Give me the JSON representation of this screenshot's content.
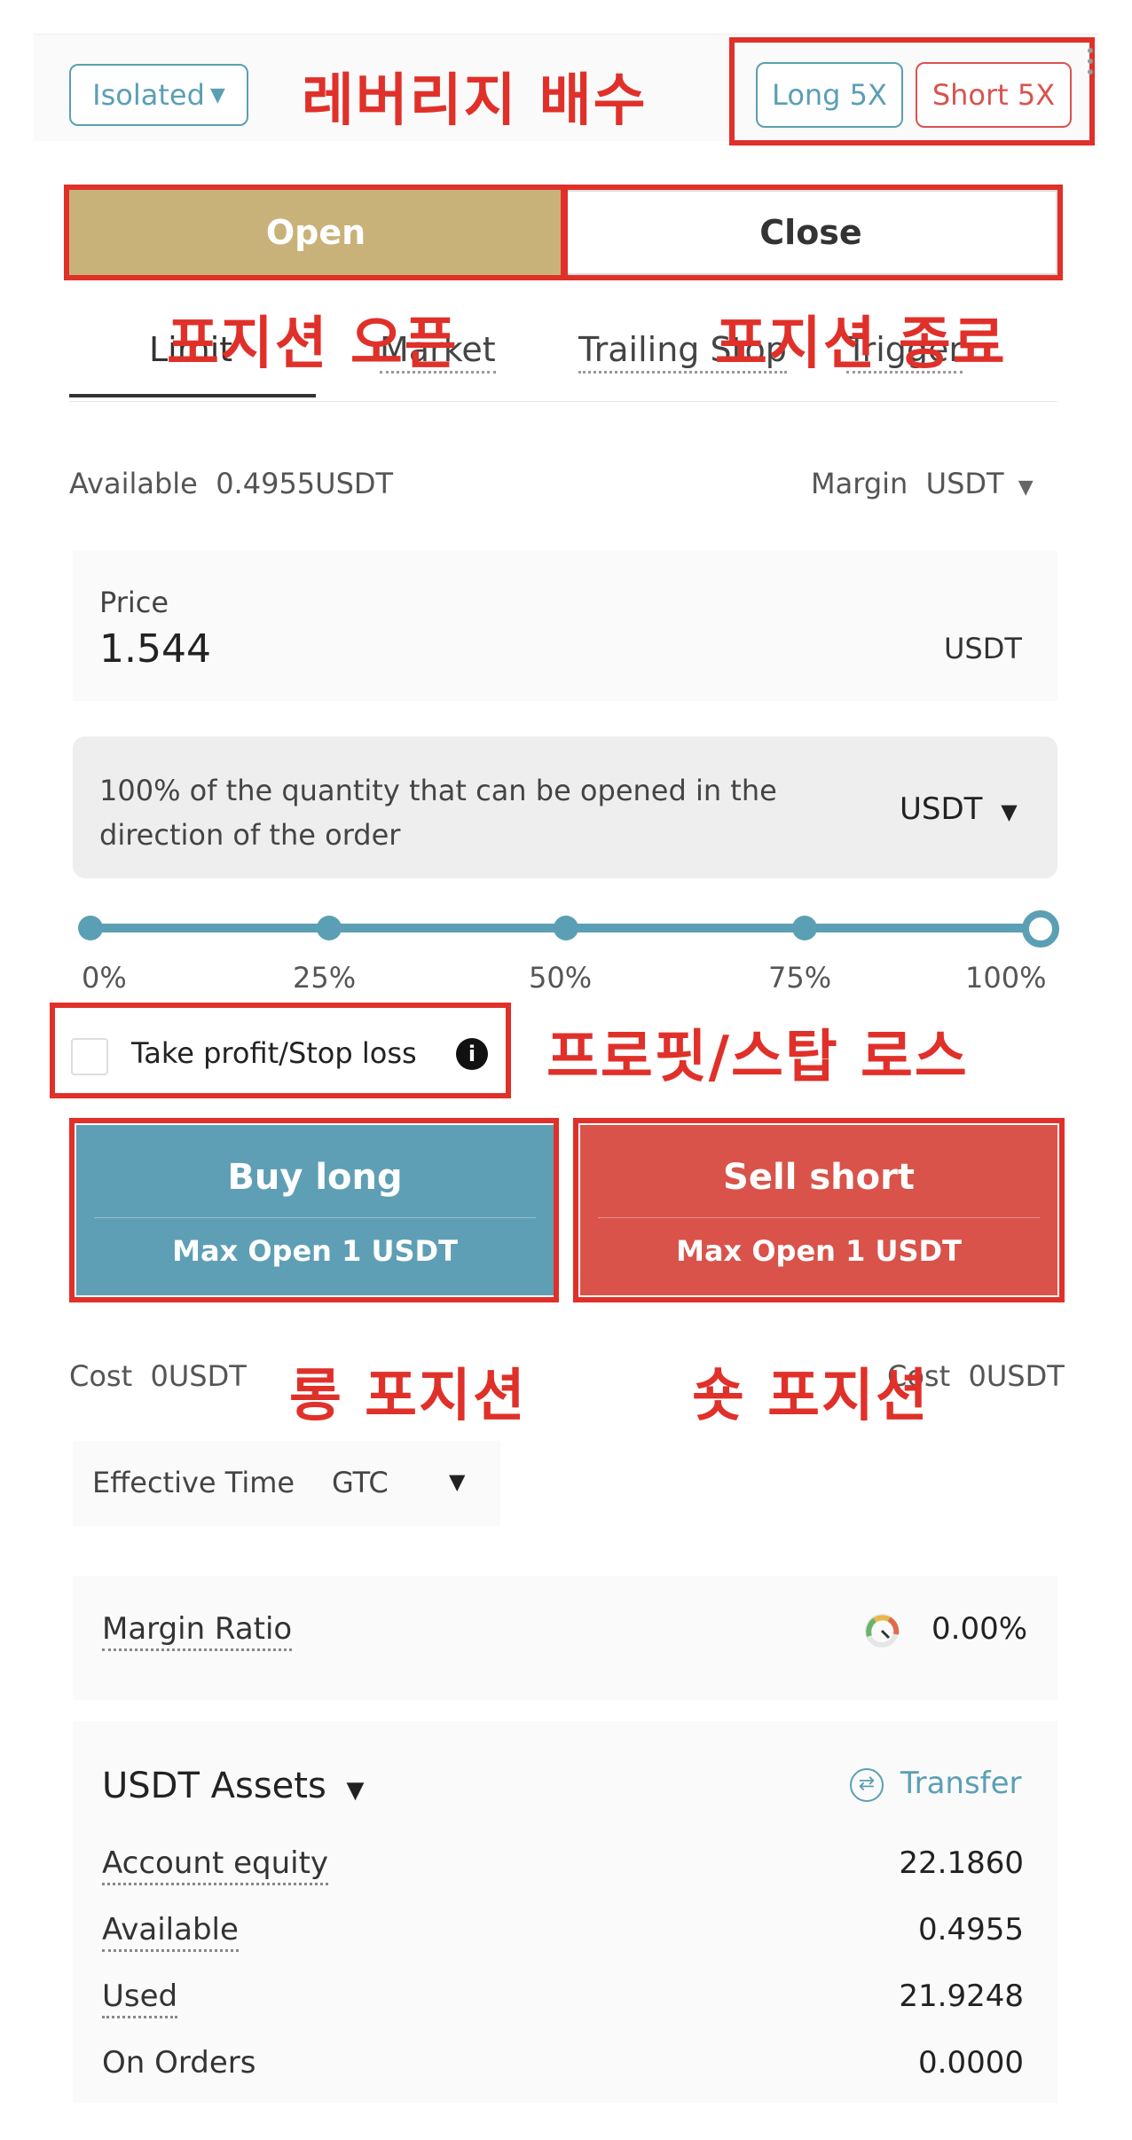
{
  "header": {
    "margin_mode": "Isolated",
    "long_leverage": "Long 5X",
    "short_leverage": "Short 5X"
  },
  "annotations": {
    "leverage": "레버리지 배수",
    "open_position": "포지션 오픈",
    "close_position": "포지션 종료",
    "take_profit_stop_loss": "프로핏/스탑 로스",
    "long_position": "롱 포지션",
    "short_position": "숏 포지션"
  },
  "mode_toggle": {
    "open": "Open",
    "close": "Close"
  },
  "order_tabs": [
    {
      "label": "Limit",
      "active": true
    },
    {
      "label": "Market"
    },
    {
      "label": "Trailing Stop"
    },
    {
      "label": "Trigger"
    }
  ],
  "available": {
    "label": "Available",
    "value": "0.4955USDT"
  },
  "margin": {
    "label": "Margin",
    "currency": "USDT"
  },
  "price": {
    "label": "Price",
    "value": "1.544",
    "unit": "USDT"
  },
  "quantity": {
    "text": "100% of the quantity that can be opened in the direction of the order",
    "unit": "USDT"
  },
  "slider": {
    "marks": [
      "0%",
      "25%",
      "50%",
      "75%",
      "100%"
    ],
    "value_percent": 100
  },
  "tpsl": {
    "label": "Take profit/Stop loss",
    "checked": false
  },
  "actions": {
    "buy": {
      "label": "Buy long",
      "sub": "Max Open 1 USDT",
      "color": "#5e9fb5"
    },
    "sell": {
      "label": "Sell short",
      "sub": "Max Open 1 USDT",
      "color": "#d9534a"
    }
  },
  "cost": {
    "left_label": "Cost",
    "left_value": "0USDT",
    "right_label": "Cost",
    "right_value": "0USDT"
  },
  "effective_time": {
    "label": "Effective Time",
    "value": "GTC"
  },
  "margin_ratio": {
    "label": "Margin Ratio",
    "value": "0.00%"
  },
  "assets": {
    "title": "USDT Assets",
    "transfer": "Transfer",
    "rows": [
      {
        "label": "Account equity",
        "value": "22.1860"
      },
      {
        "label": "Available",
        "value": "0.4955"
      },
      {
        "label": "Used",
        "value": "21.9248"
      },
      {
        "label": "On Orders",
        "value": "0.0000"
      }
    ]
  },
  "colors": {
    "accent": "#5b9fb4",
    "danger": "#d9534f",
    "annotation": "#e0302a",
    "open_active": "#c8b27a"
  }
}
